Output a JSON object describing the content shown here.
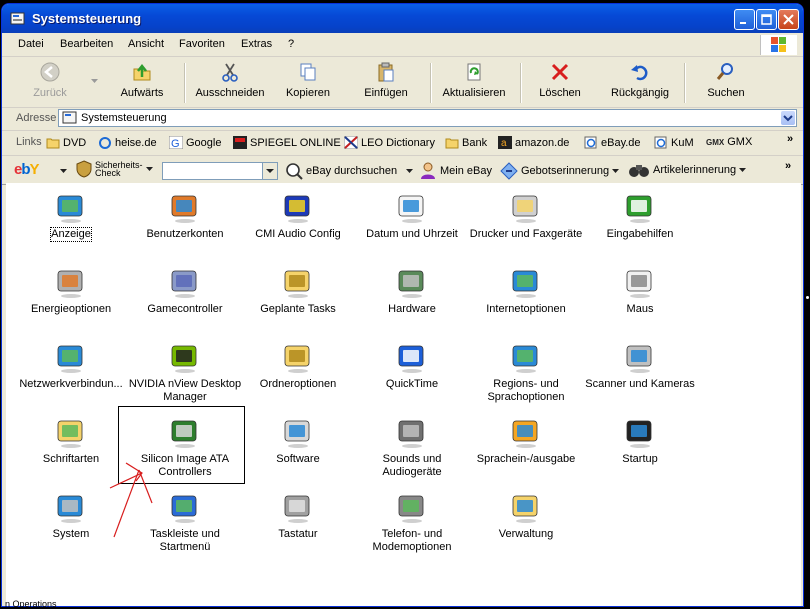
{
  "window": {
    "title": "Systemsteuerung"
  },
  "menu": [
    "Datei",
    "Bearbeiten",
    "Ansicht",
    "Favoriten",
    "Extras",
    "?"
  ],
  "toolbar": [
    {
      "label": "Zurück",
      "icon": "back-arrow-icon",
      "enabled": false
    },
    {
      "label": "Aufwärts",
      "icon": "folder-up-icon",
      "enabled": true
    },
    {
      "label": "Ausschneiden",
      "icon": "scissors-icon",
      "enabled": true
    },
    {
      "label": "Kopieren",
      "icon": "copy-icon",
      "enabled": true
    },
    {
      "label": "Einfügen",
      "icon": "paste-icon",
      "enabled": true
    },
    {
      "label": "Aktualisieren",
      "icon": "refresh-icon",
      "enabled": true
    },
    {
      "label": "Löschen",
      "icon": "delete-x-icon",
      "enabled": true
    },
    {
      "label": "Rückgängig",
      "icon": "undo-icon",
      "enabled": true
    },
    {
      "label": "Suchen",
      "icon": "search-icon",
      "enabled": true
    }
  ],
  "address": {
    "label": "Adresse",
    "value": "Systemsteuerung"
  },
  "links": {
    "label": "Links",
    "items": [
      "DVD",
      "heise.de",
      "Google",
      "SPIEGEL ONLINE",
      "LEO Dictionary",
      "Bank",
      "amazon.de",
      "eBay.de",
      "KuM",
      "GMX"
    ],
    "more": "»"
  },
  "ebay": {
    "logo": "ebY",
    "security_check": "Sicherheits-\nCheck",
    "search": "eBay durchsuchen",
    "my_ebay": "Mein eBay",
    "bid_reminder": "Gebotserinnerung",
    "item_reminder": "Artikelerinnerung",
    "more": "»"
  },
  "control_panel_items": [
    {
      "label": "Anzeige",
      "icon": "display-icon"
    },
    {
      "label": "Benutzerkonten",
      "icon": "user-accounts-icon"
    },
    {
      "label": "CMI Audio Config",
      "icon": "cmi-audio-icon"
    },
    {
      "label": "Datum und Uhrzeit",
      "icon": "date-time-icon"
    },
    {
      "label": "Drucker und Faxgeräte",
      "icon": "printer-icon"
    },
    {
      "label": "Eingabehilfen",
      "icon": "accessibility-icon"
    },
    {
      "label": "Energieoptionen",
      "icon": "power-options-icon"
    },
    {
      "label": "Gamecontroller",
      "icon": "gamepad-icon"
    },
    {
      "label": "Geplante Tasks",
      "icon": "scheduled-tasks-icon"
    },
    {
      "label": "Hardware",
      "icon": "hardware-icon"
    },
    {
      "label": "Internetoptionen",
      "icon": "internet-options-icon"
    },
    {
      "label": "Maus",
      "icon": "mouse-icon"
    },
    {
      "label": "Netzwerkverbindun...",
      "icon": "network-icon"
    },
    {
      "label": "NVIDIA nView Desktop Manager",
      "icon": "nvidia-icon"
    },
    {
      "label": "Ordneroptionen",
      "icon": "folder-options-icon"
    },
    {
      "label": "QuickTime",
      "icon": "quicktime-icon"
    },
    {
      "label": "Regions- und Sprachoptionen",
      "icon": "globe-icon"
    },
    {
      "label": "Scanner und Kameras",
      "icon": "scanner-icon"
    },
    {
      "label": "Schriftarten",
      "icon": "fonts-folder-icon"
    },
    {
      "label": "Silicon Image ATA Controllers",
      "icon": "ata-controller-icon"
    },
    {
      "label": "Software",
      "icon": "software-icon"
    },
    {
      "label": "Sounds und Audiogeräte",
      "icon": "speaker-icon"
    },
    {
      "label": "Sprachein-/ausgabe",
      "icon": "speech-icon"
    },
    {
      "label": "Startup",
      "icon": "startup-monitor-icon"
    },
    {
      "label": "System",
      "icon": "system-icon"
    },
    {
      "label": "Taskleiste und Startmenü",
      "icon": "taskbar-icon"
    },
    {
      "label": "Tastatur",
      "icon": "keyboard-icon"
    },
    {
      "label": "Telefon- und Modemoptionen",
      "icon": "phone-modem-icon"
    },
    {
      "label": "Verwaltung",
      "icon": "admin-tools-icon"
    }
  ],
  "footer_text": "n Operations"
}
